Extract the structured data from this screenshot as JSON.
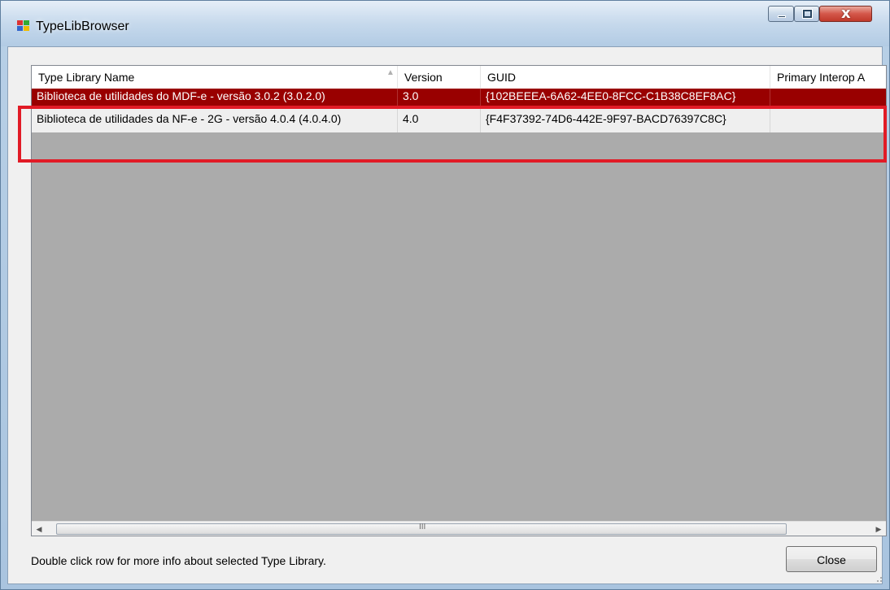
{
  "window": {
    "title": "TypeLibBrowser",
    "close_glyph": "x"
  },
  "list": {
    "columns": [
      "Type Library Name",
      "Version",
      "GUID",
      "Primary Interop A"
    ],
    "rows": [
      {
        "name": "Biblioteca de utilidades do MDF-e - versão 3.0.2 (3.0.2.0)",
        "version": "3.0",
        "guid": "{102BEEEA-6A62-4EE0-8FCC-C1B38C8EF8AC}",
        "interop": ""
      },
      {
        "name": "Biblioteca de utilidades da NF-e - 2G - versão 4.0.4  (4.0.4.0)",
        "version": "4.0",
        "guid": "{F4F37392-74D6-442E-9F97-BACD76397C8C}",
        "interop": ""
      }
    ]
  },
  "scroll": {
    "left": "◀",
    "right": "▶",
    "grip": "III"
  },
  "footer": {
    "hint": "Double click row for more info about selected Type Library.",
    "close_label": "Close"
  },
  "colors": {
    "selected_row": "#990000",
    "highlight_box": "#e11b26"
  }
}
